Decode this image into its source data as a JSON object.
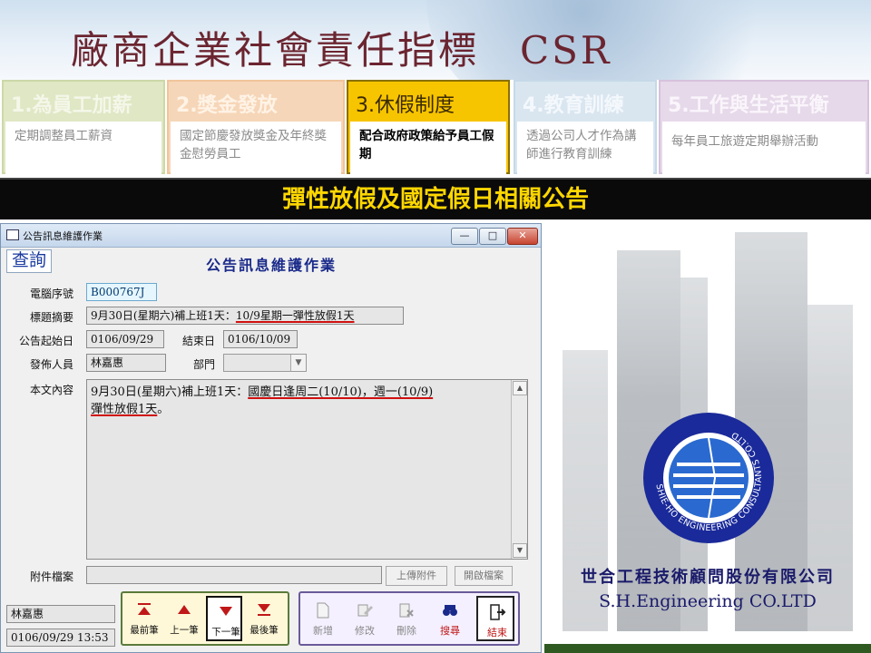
{
  "header": {
    "title": "廠商企業社會責任指標　CSR"
  },
  "tabs": [
    {
      "title": "1.為員工加薪",
      "desc": "定期調整員工薪資"
    },
    {
      "title": "2.獎金發放",
      "desc": "國定節慶發放獎金及年終獎金慰勞員工"
    },
    {
      "title": "3.休假制度",
      "desc": "配合政府政策給予員工假期",
      "active": true
    },
    {
      "title": "4.教育訓練",
      "desc": "透過公司人才作為講師進行教育訓練"
    },
    {
      "title": "5.工作與生活平衡",
      "desc": "每年員工旅遊定期舉辦活動"
    }
  ],
  "banner": {
    "text": "彈性放假及國定假日相關公告"
  },
  "window": {
    "title": "公告訊息維護作業",
    "controls": {
      "minimize": "—",
      "maximize": "□",
      "close": "✕"
    },
    "mode_label": "查詢",
    "form_title": "公告訊息維護作業",
    "fields": {
      "serial_label": "電腦序號",
      "serial_value": "B000767J",
      "subject_label": "標題摘要",
      "subject_prefix": "9月30日(星期六)補上班1天：",
      "subject_highlight": "10/9星期一彈性放假1天",
      "start_label": "公告起始日",
      "start_value": "0106/09/29",
      "end_label": "結束日",
      "end_value": "0106/10/09",
      "publisher_label": "發佈人員",
      "publisher_value": "林嘉惠",
      "dept_label": "部門",
      "dept_value": "",
      "body_label": "本文內容",
      "body_prefix": "9月30日(星期六)補上班1天：",
      "body_highlight1": "國慶日逢周二(10/10)，週一(10/9)",
      "body_highlight2": "彈性放假1天",
      "body_suffix": "。",
      "attach_label": "附件檔案",
      "attach_value": ""
    },
    "buttons": {
      "upload": "上傳附件",
      "open": "開啟檔案",
      "first": "最前筆",
      "prev": "上一筆",
      "next": "下一筆",
      "last": "最後筆",
      "add": "新增",
      "edit": "修改",
      "delete": "刪除",
      "search": "搜尋",
      "exit": "結束"
    },
    "status": {
      "user": "林嘉惠",
      "datetime": "0106/09/29 13:53"
    }
  },
  "company": {
    "logo_text": "SHIE-HO ENGINEERING CONSULTANTS CO.LTD",
    "name_zh": "世合工程技術顧問股份有限公司",
    "name_en": "S.H.Engineering CO.LTD"
  },
  "colors": {
    "active_tab": "#f7c400",
    "banner_text": "#ffd700",
    "highlight_underline": "#d01010"
  }
}
